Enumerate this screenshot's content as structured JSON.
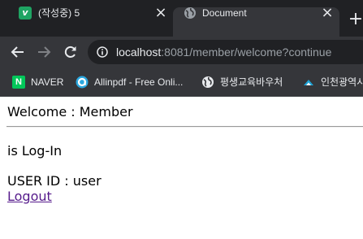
{
  "tabs": [
    {
      "title": "(작성중) 5",
      "icon": "velog-favicon-icon",
      "active": false
    },
    {
      "title": "Document",
      "icon": "globe-icon",
      "active": true
    }
  ],
  "address_bar": {
    "host": "localhost",
    "rest": ":8081/member/welcome?continue"
  },
  "bookmarks": [
    {
      "label": "NAVER",
      "icon": "naver-icon"
    },
    {
      "label": "Allinpdf - Free Onli...",
      "icon": "allinpdf-icon"
    },
    {
      "label": "평생교육바우처",
      "icon": "globe-icon"
    },
    {
      "label": "인천광역시",
      "icon": "incheon-icon"
    }
  ],
  "page": {
    "heading": "Welcome : Member",
    "status": "is Log-In",
    "user_id": "USER ID : user",
    "logout_label": "Logout"
  },
  "colors": {
    "tabstrip_bg": "#202124",
    "toolbar_bg": "#35363a",
    "visited_link": "#551a8b"
  }
}
